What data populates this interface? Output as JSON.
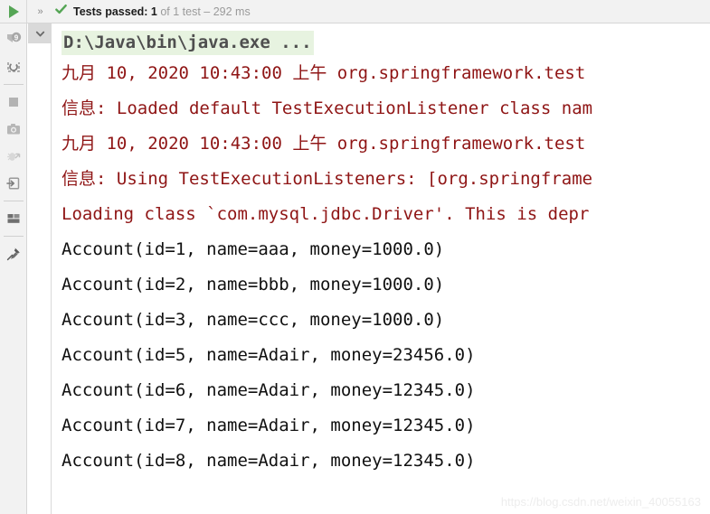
{
  "window": {
    "title": "Run Tool Window"
  },
  "toolbar": {
    "run_button_label": "Run",
    "overflow_label": "»",
    "check_icon": "check-icon",
    "status_primary": "Tests passed: 1",
    "status_secondary": "of 1 test – 292 ms",
    "status_color": "#55a555"
  },
  "sidebar": {
    "items": [
      {
        "name": "rerun-tests-button",
        "icon": "rerun-icon",
        "tooltip": "Rerun tests",
        "enabled": true
      },
      {
        "name": "rerun-failed-tests-button",
        "icon": "rerun-failed-icon",
        "tooltip": "Rerun failed tests",
        "enabled": true
      },
      {
        "name": "stop-button",
        "icon": "stop-square-icon",
        "tooltip": "Stop",
        "enabled": true
      },
      {
        "name": "export-results-button",
        "icon": "camera-icon",
        "tooltip": "Export test results",
        "enabled": true
      },
      {
        "name": "toggle-coverage-button",
        "icon": "bug-arrow-icon",
        "tooltip": "Run with coverage",
        "enabled": false
      },
      {
        "name": "import-results-button",
        "icon": "import-arrow-icon",
        "tooltip": "Import test results",
        "enabled": true
      },
      {
        "name": "layout-settings-button",
        "icon": "layout-grid-icon",
        "tooltip": "Layout settings",
        "enabled": true
      },
      {
        "name": "pin-tab-button",
        "icon": "pin-icon",
        "tooltip": "Pin tab",
        "enabled": true
      }
    ]
  },
  "gutter": {
    "collapse_icon": "chevron-down-icon"
  },
  "console": {
    "lines": [
      {
        "id": "cmd",
        "kind": "cmd",
        "text": "D:\\Java\\bin\\java.exe ..."
      },
      {
        "id": "log-1",
        "kind": "err",
        "text": "九月 10, 2020 10:43:00 上午 org.springframework.test"
      },
      {
        "id": "log-2",
        "kind": "err",
        "text": "信息: Loaded default TestExecutionListener class nam"
      },
      {
        "id": "log-3",
        "kind": "err",
        "text": "九月 10, 2020 10:43:00 上午 org.springframework.test"
      },
      {
        "id": "log-4",
        "kind": "err",
        "text": "信息: Using TestExecutionListeners: [org.springframe"
      },
      {
        "id": "log-5",
        "kind": "err",
        "text": "Loading class `com.mysql.jdbc.Driver'. This is depr"
      },
      {
        "id": "out-1",
        "kind": "out",
        "text": "Account(id=1, name=aaa, money=1000.0)"
      },
      {
        "id": "out-2",
        "kind": "out",
        "text": "Account(id=2, name=bbb, money=1000.0)"
      },
      {
        "id": "out-3",
        "kind": "out",
        "text": "Account(id=3, name=ccc, money=1000.0)"
      },
      {
        "id": "out-4",
        "kind": "out",
        "text": "Account(id=5, name=Adair, money=23456.0)"
      },
      {
        "id": "out-5",
        "kind": "out",
        "text": "Account(id=6, name=Adair, money=12345.0)"
      },
      {
        "id": "out-6",
        "kind": "out",
        "text": "Account(id=7, name=Adair, money=12345.0)"
      },
      {
        "id": "out-7",
        "kind": "out",
        "text": "Account(id=8, name=Adair, money=12345.0)"
      }
    ]
  },
  "watermark": {
    "text": "https://blog.csdn.net/weixin_40055163"
  },
  "colors": {
    "error_text": "#8f1515",
    "command_text": "#4f4f4f",
    "command_highlight": "#e7f3e0",
    "output_text": "#101010",
    "pass_green": "#55a555",
    "chrome": "#f2f2f2"
  }
}
